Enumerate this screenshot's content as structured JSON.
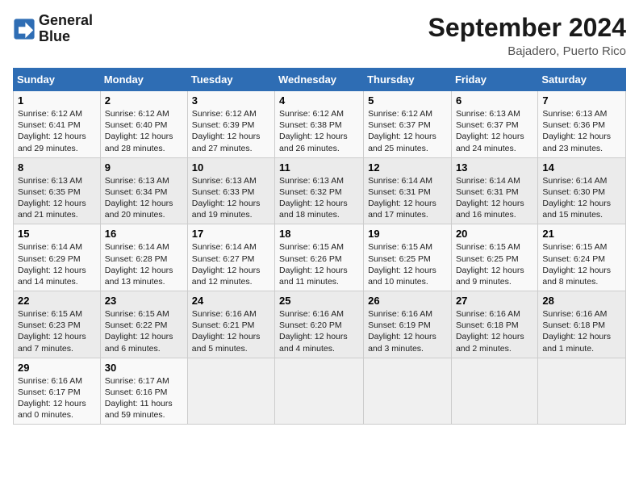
{
  "header": {
    "logo_line1": "General",
    "logo_line2": "Blue",
    "month": "September 2024",
    "location": "Bajadero, Puerto Rico"
  },
  "days_of_week": [
    "Sunday",
    "Monday",
    "Tuesday",
    "Wednesday",
    "Thursday",
    "Friday",
    "Saturday"
  ],
  "weeks": [
    [
      {
        "day": "1",
        "sunrise": "6:12 AM",
        "sunset": "6:41 PM",
        "daylight": "12 hours and 29 minutes."
      },
      {
        "day": "2",
        "sunrise": "6:12 AM",
        "sunset": "6:40 PM",
        "daylight": "12 hours and 28 minutes."
      },
      {
        "day": "3",
        "sunrise": "6:12 AM",
        "sunset": "6:39 PM",
        "daylight": "12 hours and 27 minutes."
      },
      {
        "day": "4",
        "sunrise": "6:12 AM",
        "sunset": "6:38 PM",
        "daylight": "12 hours and 26 minutes."
      },
      {
        "day": "5",
        "sunrise": "6:12 AM",
        "sunset": "6:37 PM",
        "daylight": "12 hours and 25 minutes."
      },
      {
        "day": "6",
        "sunrise": "6:13 AM",
        "sunset": "6:37 PM",
        "daylight": "12 hours and 24 minutes."
      },
      {
        "day": "7",
        "sunrise": "6:13 AM",
        "sunset": "6:36 PM",
        "daylight": "12 hours and 23 minutes."
      }
    ],
    [
      {
        "day": "8",
        "sunrise": "6:13 AM",
        "sunset": "6:35 PM",
        "daylight": "12 hours and 21 minutes."
      },
      {
        "day": "9",
        "sunrise": "6:13 AM",
        "sunset": "6:34 PM",
        "daylight": "12 hours and 20 minutes."
      },
      {
        "day": "10",
        "sunrise": "6:13 AM",
        "sunset": "6:33 PM",
        "daylight": "12 hours and 19 minutes."
      },
      {
        "day": "11",
        "sunrise": "6:13 AM",
        "sunset": "6:32 PM",
        "daylight": "12 hours and 18 minutes."
      },
      {
        "day": "12",
        "sunrise": "6:14 AM",
        "sunset": "6:31 PM",
        "daylight": "12 hours and 17 minutes."
      },
      {
        "day": "13",
        "sunrise": "6:14 AM",
        "sunset": "6:31 PM",
        "daylight": "12 hours and 16 minutes."
      },
      {
        "day": "14",
        "sunrise": "6:14 AM",
        "sunset": "6:30 PM",
        "daylight": "12 hours and 15 minutes."
      }
    ],
    [
      {
        "day": "15",
        "sunrise": "6:14 AM",
        "sunset": "6:29 PM",
        "daylight": "12 hours and 14 minutes."
      },
      {
        "day": "16",
        "sunrise": "6:14 AM",
        "sunset": "6:28 PM",
        "daylight": "12 hours and 13 minutes."
      },
      {
        "day": "17",
        "sunrise": "6:14 AM",
        "sunset": "6:27 PM",
        "daylight": "12 hours and 12 minutes."
      },
      {
        "day": "18",
        "sunrise": "6:15 AM",
        "sunset": "6:26 PM",
        "daylight": "12 hours and 11 minutes."
      },
      {
        "day": "19",
        "sunrise": "6:15 AM",
        "sunset": "6:25 PM",
        "daylight": "12 hours and 10 minutes."
      },
      {
        "day": "20",
        "sunrise": "6:15 AM",
        "sunset": "6:25 PM",
        "daylight": "12 hours and 9 minutes."
      },
      {
        "day": "21",
        "sunrise": "6:15 AM",
        "sunset": "6:24 PM",
        "daylight": "12 hours and 8 minutes."
      }
    ],
    [
      {
        "day": "22",
        "sunrise": "6:15 AM",
        "sunset": "6:23 PM",
        "daylight": "12 hours and 7 minutes."
      },
      {
        "day": "23",
        "sunrise": "6:15 AM",
        "sunset": "6:22 PM",
        "daylight": "12 hours and 6 minutes."
      },
      {
        "day": "24",
        "sunrise": "6:16 AM",
        "sunset": "6:21 PM",
        "daylight": "12 hours and 5 minutes."
      },
      {
        "day": "25",
        "sunrise": "6:16 AM",
        "sunset": "6:20 PM",
        "daylight": "12 hours and 4 minutes."
      },
      {
        "day": "26",
        "sunrise": "6:16 AM",
        "sunset": "6:19 PM",
        "daylight": "12 hours and 3 minutes."
      },
      {
        "day": "27",
        "sunrise": "6:16 AM",
        "sunset": "6:18 PM",
        "daylight": "12 hours and 2 minutes."
      },
      {
        "day": "28",
        "sunrise": "6:16 AM",
        "sunset": "6:18 PM",
        "daylight": "12 hours and 1 minute."
      }
    ],
    [
      {
        "day": "29",
        "sunrise": "6:16 AM",
        "sunset": "6:17 PM",
        "daylight": "12 hours and 0 minutes."
      },
      {
        "day": "30",
        "sunrise": "6:17 AM",
        "sunset": "6:16 PM",
        "daylight": "11 hours and 59 minutes."
      },
      {
        "day": "",
        "sunrise": "",
        "sunset": "",
        "daylight": ""
      },
      {
        "day": "",
        "sunrise": "",
        "sunset": "",
        "daylight": ""
      },
      {
        "day": "",
        "sunrise": "",
        "sunset": "",
        "daylight": ""
      },
      {
        "day": "",
        "sunrise": "",
        "sunset": "",
        "daylight": ""
      },
      {
        "day": "",
        "sunrise": "",
        "sunset": "",
        "daylight": ""
      }
    ]
  ]
}
